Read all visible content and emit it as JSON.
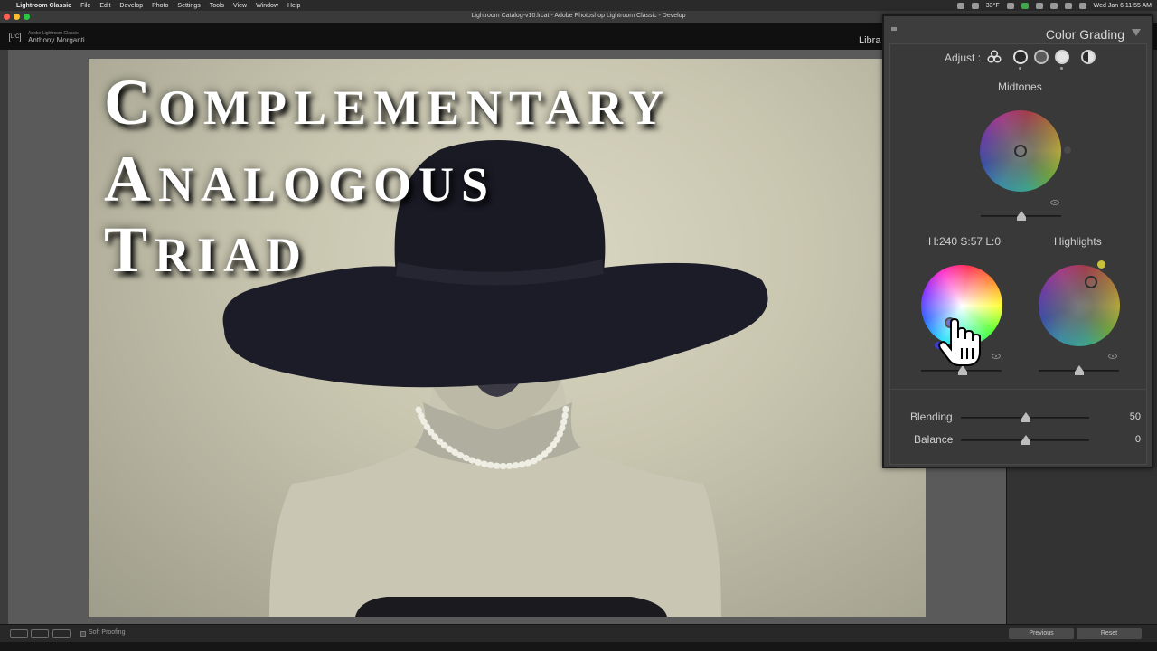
{
  "menubar": {
    "items": [
      "Lightroom Classic",
      "File",
      "Edit",
      "Develop",
      "Photo",
      "Settings",
      "Tools",
      "View",
      "Window",
      "Help"
    ],
    "temp": "33°F",
    "datetime": "Wed Jan 6  11:55 AM"
  },
  "window": {
    "title": "Lightroom Catalog-v10.lrcat - Adobe Photoshop Lightroom Classic - Develop"
  },
  "identity": {
    "brand": "Adobe Lightroom Classic",
    "user": "Anthony Morganti",
    "logo": "LrC",
    "module_partial": "Libra"
  },
  "photo": {
    "overlay_lines": [
      {
        "cap": "C",
        "rest": "OMPLEMENTARY"
      },
      {
        "cap": "A",
        "rest": "NALOGOUS"
      },
      {
        "cap": "T",
        "rest": "RIAD"
      }
    ]
  },
  "toolbar": {
    "soft_proofing": "Soft Proofing",
    "previous": "Previous",
    "reset": "Reset"
  },
  "color_grading": {
    "title": "Color Grading",
    "adjust_label": "Adjust :",
    "midtones_label": "Midtones",
    "shadows_readout": "H:240 S:57 L:0",
    "highlights_label": "Highlights",
    "blending_label": "Blending",
    "blending_value": "50",
    "balance_label": "Balance",
    "balance_value": "0",
    "accent_highlight_dot": "#c8c23a"
  }
}
